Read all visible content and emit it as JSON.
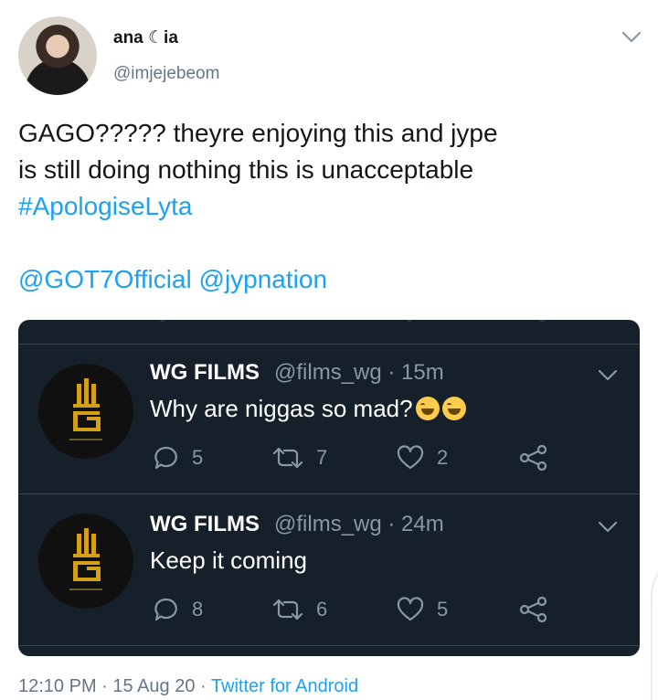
{
  "tweet": {
    "display_name": "ana ☾ia",
    "handle": "@imjejebeom",
    "text_lines": [
      "GAGO????? theyre enjoying this and jype",
      "is still doing nothing this is unacceptable"
    ],
    "hashtag": "#ApologiseLyta",
    "mentions": [
      "@GOT7Official",
      "@jypnation"
    ],
    "time": "12:10 PM",
    "date": "15 Aug 20",
    "source": "Twitter for Android",
    "separator": " · "
  },
  "embedded_tweets": [
    {
      "name": "WG FILMS",
      "handle": "@films_wg",
      "time": "15m",
      "text": "Why are niggas so mad?",
      "emojis": [
        "grinning-squinting-face",
        "grinning-squinting-face"
      ],
      "replies": "5",
      "retweets": "7",
      "likes": "2"
    },
    {
      "name": "WG FILMS",
      "handle": "@films_wg",
      "time": "24m",
      "text": "Keep it coming",
      "emojis": [],
      "replies": "8",
      "retweets": "6",
      "likes": "5"
    }
  ],
  "colors": {
    "link": "#1da1f2",
    "secondary": "#657786",
    "dark_bg": "#15202b",
    "logo_gold": "#d4a017"
  },
  "icons": [
    "chevron-down-icon",
    "reply-icon",
    "retweet-icon",
    "like-icon",
    "share-icon",
    "wg-films-logo"
  ]
}
